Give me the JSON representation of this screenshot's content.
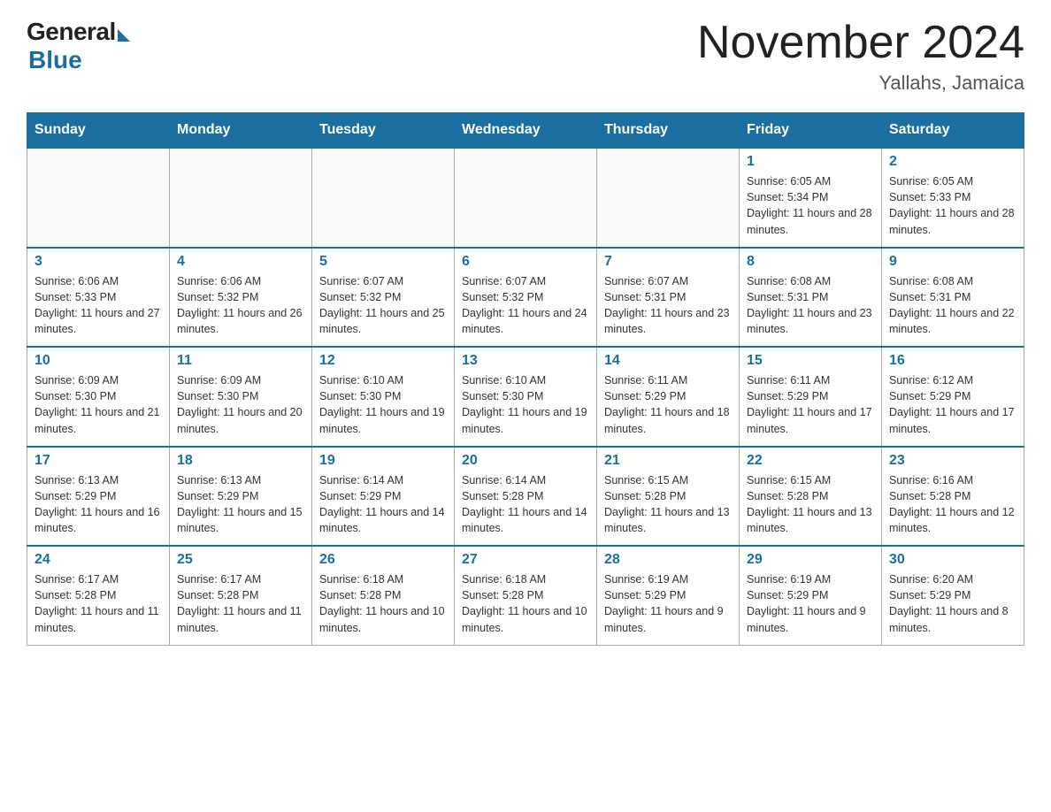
{
  "header": {
    "logo_general": "General",
    "logo_blue": "Blue",
    "month_title": "November 2024",
    "location": "Yallahs, Jamaica"
  },
  "weekdays": [
    "Sunday",
    "Monday",
    "Tuesday",
    "Wednesday",
    "Thursday",
    "Friday",
    "Saturday"
  ],
  "weeks": [
    [
      {
        "day": "",
        "info": ""
      },
      {
        "day": "",
        "info": ""
      },
      {
        "day": "",
        "info": ""
      },
      {
        "day": "",
        "info": ""
      },
      {
        "day": "",
        "info": ""
      },
      {
        "day": "1",
        "info": "Sunrise: 6:05 AM\nSunset: 5:34 PM\nDaylight: 11 hours and 28 minutes."
      },
      {
        "day": "2",
        "info": "Sunrise: 6:05 AM\nSunset: 5:33 PM\nDaylight: 11 hours and 28 minutes."
      }
    ],
    [
      {
        "day": "3",
        "info": "Sunrise: 6:06 AM\nSunset: 5:33 PM\nDaylight: 11 hours and 27 minutes."
      },
      {
        "day": "4",
        "info": "Sunrise: 6:06 AM\nSunset: 5:32 PM\nDaylight: 11 hours and 26 minutes."
      },
      {
        "day": "5",
        "info": "Sunrise: 6:07 AM\nSunset: 5:32 PM\nDaylight: 11 hours and 25 minutes."
      },
      {
        "day": "6",
        "info": "Sunrise: 6:07 AM\nSunset: 5:32 PM\nDaylight: 11 hours and 24 minutes."
      },
      {
        "day": "7",
        "info": "Sunrise: 6:07 AM\nSunset: 5:31 PM\nDaylight: 11 hours and 23 minutes."
      },
      {
        "day": "8",
        "info": "Sunrise: 6:08 AM\nSunset: 5:31 PM\nDaylight: 11 hours and 23 minutes."
      },
      {
        "day": "9",
        "info": "Sunrise: 6:08 AM\nSunset: 5:31 PM\nDaylight: 11 hours and 22 minutes."
      }
    ],
    [
      {
        "day": "10",
        "info": "Sunrise: 6:09 AM\nSunset: 5:30 PM\nDaylight: 11 hours and 21 minutes."
      },
      {
        "day": "11",
        "info": "Sunrise: 6:09 AM\nSunset: 5:30 PM\nDaylight: 11 hours and 20 minutes."
      },
      {
        "day": "12",
        "info": "Sunrise: 6:10 AM\nSunset: 5:30 PM\nDaylight: 11 hours and 19 minutes."
      },
      {
        "day": "13",
        "info": "Sunrise: 6:10 AM\nSunset: 5:30 PM\nDaylight: 11 hours and 19 minutes."
      },
      {
        "day": "14",
        "info": "Sunrise: 6:11 AM\nSunset: 5:29 PM\nDaylight: 11 hours and 18 minutes."
      },
      {
        "day": "15",
        "info": "Sunrise: 6:11 AM\nSunset: 5:29 PM\nDaylight: 11 hours and 17 minutes."
      },
      {
        "day": "16",
        "info": "Sunrise: 6:12 AM\nSunset: 5:29 PM\nDaylight: 11 hours and 17 minutes."
      }
    ],
    [
      {
        "day": "17",
        "info": "Sunrise: 6:13 AM\nSunset: 5:29 PM\nDaylight: 11 hours and 16 minutes."
      },
      {
        "day": "18",
        "info": "Sunrise: 6:13 AM\nSunset: 5:29 PM\nDaylight: 11 hours and 15 minutes."
      },
      {
        "day": "19",
        "info": "Sunrise: 6:14 AM\nSunset: 5:29 PM\nDaylight: 11 hours and 14 minutes."
      },
      {
        "day": "20",
        "info": "Sunrise: 6:14 AM\nSunset: 5:28 PM\nDaylight: 11 hours and 14 minutes."
      },
      {
        "day": "21",
        "info": "Sunrise: 6:15 AM\nSunset: 5:28 PM\nDaylight: 11 hours and 13 minutes."
      },
      {
        "day": "22",
        "info": "Sunrise: 6:15 AM\nSunset: 5:28 PM\nDaylight: 11 hours and 13 minutes."
      },
      {
        "day": "23",
        "info": "Sunrise: 6:16 AM\nSunset: 5:28 PM\nDaylight: 11 hours and 12 minutes."
      }
    ],
    [
      {
        "day": "24",
        "info": "Sunrise: 6:17 AM\nSunset: 5:28 PM\nDaylight: 11 hours and 11 minutes."
      },
      {
        "day": "25",
        "info": "Sunrise: 6:17 AM\nSunset: 5:28 PM\nDaylight: 11 hours and 11 minutes."
      },
      {
        "day": "26",
        "info": "Sunrise: 6:18 AM\nSunset: 5:28 PM\nDaylight: 11 hours and 10 minutes."
      },
      {
        "day": "27",
        "info": "Sunrise: 6:18 AM\nSunset: 5:28 PM\nDaylight: 11 hours and 10 minutes."
      },
      {
        "day": "28",
        "info": "Sunrise: 6:19 AM\nSunset: 5:29 PM\nDaylight: 11 hours and 9 minutes."
      },
      {
        "day": "29",
        "info": "Sunrise: 6:19 AM\nSunset: 5:29 PM\nDaylight: 11 hours and 9 minutes."
      },
      {
        "day": "30",
        "info": "Sunrise: 6:20 AM\nSunset: 5:29 PM\nDaylight: 11 hours and 8 minutes."
      }
    ]
  ]
}
